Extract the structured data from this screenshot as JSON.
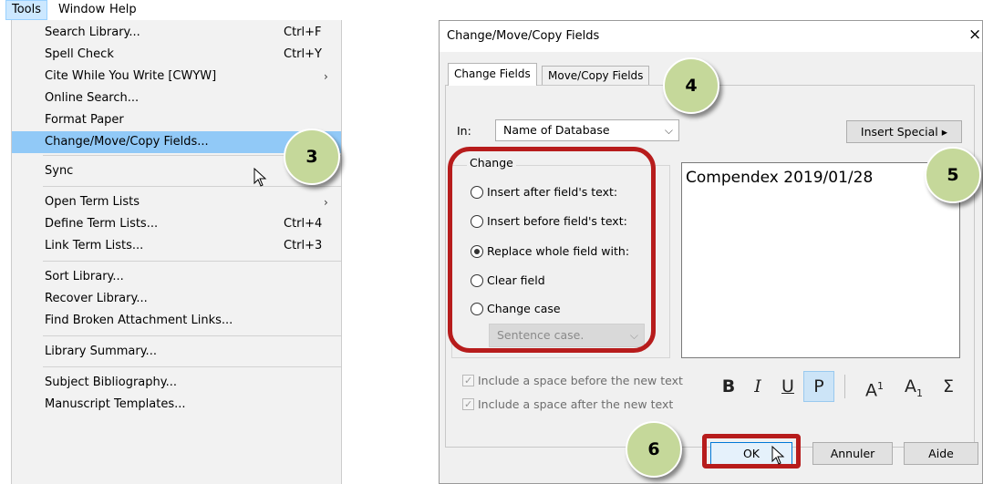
{
  "menubar": {
    "items": [
      "Tools",
      "Window",
      "Help"
    ]
  },
  "menu": {
    "items": [
      {
        "label": "Search Library...",
        "shortcut": "Ctrl+F",
        "arrow": ""
      },
      {
        "label": "Spell Check",
        "shortcut": "Ctrl+Y",
        "arrow": ""
      },
      {
        "label": "Cite While You Write [CWYW]",
        "shortcut": "",
        "arrow": "›"
      },
      {
        "label": "Online Search...",
        "shortcut": "",
        "arrow": ""
      },
      {
        "label": "Format Paper",
        "shortcut": "",
        "arrow": ""
      },
      {
        "label": "Change/Move/Copy Fields...",
        "shortcut": "",
        "arrow": ""
      },
      {
        "label": "Sync",
        "shortcut": "",
        "arrow": ""
      },
      {
        "label": "Open Term Lists",
        "shortcut": "",
        "arrow": "›"
      },
      {
        "label": "Define Term Lists...",
        "shortcut": "Ctrl+4",
        "arrow": ""
      },
      {
        "label": "Link Term Lists...",
        "shortcut": "Ctrl+3",
        "arrow": ""
      },
      {
        "label": "Sort Library...",
        "shortcut": "",
        "arrow": ""
      },
      {
        "label": "Recover Library...",
        "shortcut": "",
        "arrow": ""
      },
      {
        "label": "Find Broken Attachment Links...",
        "shortcut": "",
        "arrow": ""
      },
      {
        "label": "Library Summary...",
        "shortcut": "",
        "arrow": ""
      },
      {
        "label": "Subject Bibliography...",
        "shortcut": "",
        "arrow": ""
      },
      {
        "label": "Manuscript Templates...",
        "shortcut": "",
        "arrow": ""
      }
    ]
  },
  "bubbles": [
    "3",
    "4",
    "5",
    "6"
  ],
  "dialog": {
    "title": "Change/Move/Copy Fields",
    "close": "×",
    "tabs": [
      "Change Fields",
      "Move/Copy Fields"
    ],
    "in_label": "In:",
    "in_value": "Name of Database",
    "insert_special": "Insert Special",
    "insert_special_arrow": "▸",
    "group_label": "Change",
    "radios": [
      {
        "label": "Insert after field's text:",
        "checked": false
      },
      {
        "label": "Insert before field's text:",
        "checked": false
      },
      {
        "label": "Replace whole field with:",
        "checked": true
      },
      {
        "label": "Clear field",
        "checked": false
      },
      {
        "label": "Change case",
        "checked": false
      }
    ],
    "case_value": "Sentence case.",
    "text_value": "Compendex 2019/01/28",
    "checkboxes": [
      {
        "label": "Include a space before the new text",
        "checked": true
      },
      {
        "label": "Include a space after the new text",
        "checked": true
      }
    ],
    "format_buttons": {
      "bold": "B",
      "italic": "I",
      "underline": "U",
      "plain": "P",
      "superscript": "A",
      "superscript_mark": "1",
      "subscript": "A",
      "subscript_mark": "1",
      "symbol": "Σ"
    },
    "buttons": {
      "ok": "OK",
      "cancel": "Annuler",
      "help": "Aide"
    }
  },
  "colors": {
    "bubble": "#c5d89a",
    "highlight_outline": "#b71c1c",
    "menu_highlight": "#91c9f7"
  }
}
